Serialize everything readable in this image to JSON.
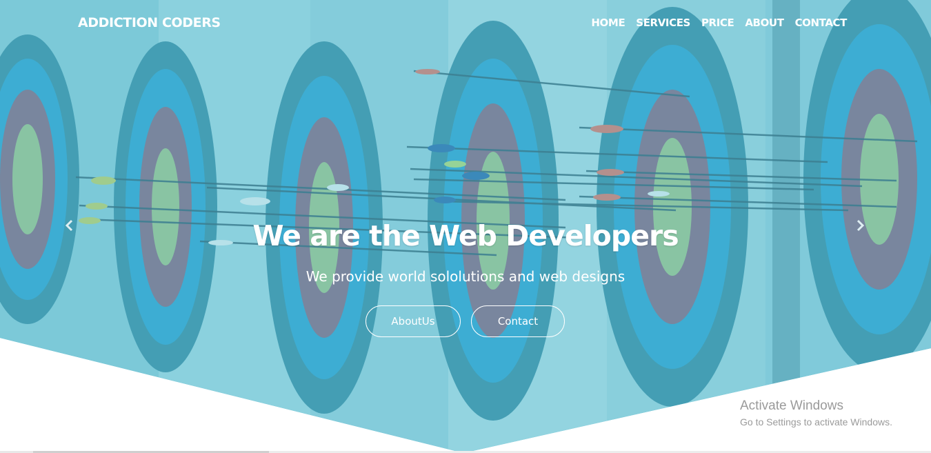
{
  "brand": {
    "name": "ADDICTION CODERS"
  },
  "nav": {
    "items": [
      {
        "label": "HOME"
      },
      {
        "label": "SERVICES"
      },
      {
        "label": "PRICE"
      },
      {
        "label": "ABOUT"
      },
      {
        "label": "CONTACT"
      }
    ]
  },
  "hero": {
    "headline": "We are the Web Developers",
    "subheadline": "We provide world sololutions and web designs",
    "buttons": {
      "about_label": "AboutUs",
      "contact_label": "Contact"
    },
    "background_subject": "archery targets with arrows",
    "overlay_color": "#58b9cf",
    "prev_icon": "chevron-left-icon",
    "next_icon": "chevron-right-icon"
  },
  "windows_watermark": {
    "title": "Activate Windows",
    "subtitle": "Go to Settings to activate Windows."
  }
}
